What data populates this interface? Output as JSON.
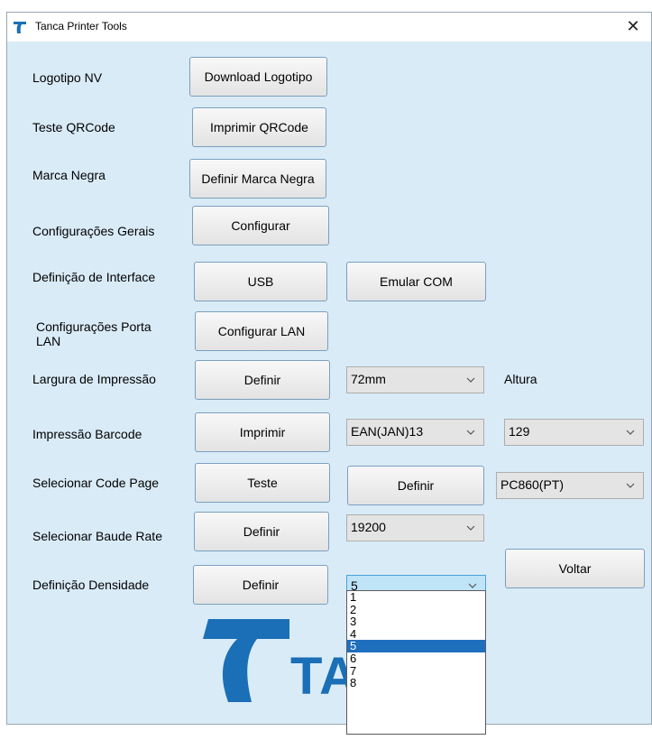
{
  "window": {
    "title": "Tanca Printer Tools",
    "close_glyph": "✕",
    "accent_color": "#1a6fb6",
    "background_color": "#d9ebf7"
  },
  "labels": {
    "logotipo": "Logotipo NV",
    "qrcode": "Teste QRCode",
    "marca": "Marca Negra",
    "config_gerais": "Configurações Gerais",
    "interface": "Definição de Interface",
    "porta_lan": "Configurações Porta\nLAN",
    "largura": "Largura de Impressão",
    "altura": "Altura",
    "barcode": "Impressão Barcode",
    "code_page": "Selecionar Code Page",
    "baude": "Selecionar Baude Rate",
    "densidade": "Definição Densidade"
  },
  "buttons": {
    "download_logotipo": "Download Logotipo",
    "imprimir_qrcode": "Imprimir QRCode",
    "definir_marca": "Definir Marca Negra",
    "configurar": "Configurar",
    "usb": "USB",
    "emular_com": "Emular COM",
    "configurar_lan": "Configurar LAN",
    "definir_largura": "Definir",
    "imprimir_barcode": "Imprimir",
    "teste_code_page": "Teste",
    "definir_code_page": "Definir",
    "definir_baude": "Definir",
    "definir_densidade": "Definir",
    "voltar": "Voltar"
  },
  "combos": {
    "largura": "72mm",
    "barcode_type": "EAN(JAN)13",
    "altura": "129",
    "code_page": "PC860(PT)",
    "baude_rate": "19200",
    "densidade": "5"
  },
  "densidade_options": [
    "1",
    "2",
    "3",
    "4",
    "5",
    "6",
    "7",
    "8"
  ],
  "densidade_selected_index": 4,
  "logo": {
    "text": "TA",
    "icon": "tanca-logo-icon"
  }
}
